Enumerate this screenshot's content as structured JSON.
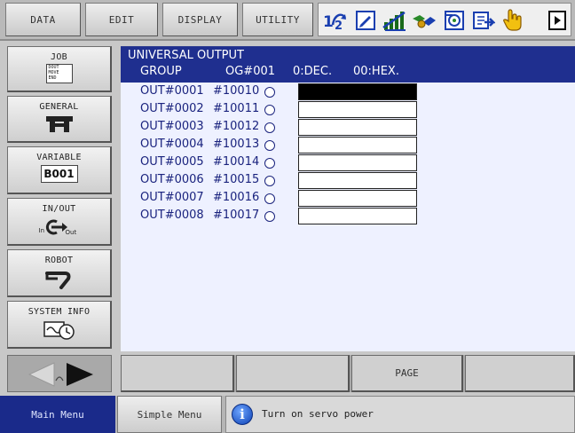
{
  "menu": {
    "data": "DATA",
    "edit": "EDIT",
    "display": "DISPLAY",
    "utility": "UTILITY"
  },
  "status_icons": [
    "teach-mode-icon",
    "edit-lock-icon",
    "signal-level-icon",
    "coordinate-tool-icon",
    "servo-status-icon",
    "play-step-icon",
    "hand-pointer-icon",
    "page-next-icon"
  ],
  "sidebar": {
    "job": {
      "label": "JOB",
      "icon": "job-document-icon",
      "icon_lines": [
        "DOUT",
        "MOVE",
        "END"
      ]
    },
    "general": {
      "label": "GENERAL",
      "icon": "general-tool-icon"
    },
    "variable": {
      "label": "VARIABLE",
      "badge": "B001"
    },
    "inout": {
      "label": "IN/OUT",
      "icon": "inout-arrow-icon",
      "in": "In",
      "out": "Out"
    },
    "robot": {
      "label": "ROBOT",
      "icon": "robot-arm-icon"
    },
    "sysinfo": {
      "label": "SYSTEM INFO",
      "icon": "system-info-icon"
    }
  },
  "panel": {
    "title": "UNIVERSAL OUTPUT",
    "group_label": "GROUP",
    "group_value": "OG#001",
    "dec_label": "0:DEC.",
    "hex_label": "00:HEX.",
    "rows": [
      {
        "name": "OUT#0001",
        "addr": "#10010"
      },
      {
        "name": "OUT#0002",
        "addr": "#10011"
      },
      {
        "name": "OUT#0003",
        "addr": "#10012"
      },
      {
        "name": "OUT#0004",
        "addr": "#10013"
      },
      {
        "name": "OUT#0005",
        "addr": "#10014"
      },
      {
        "name": "OUT#0006",
        "addr": "#10015"
      },
      {
        "name": "OUT#0007",
        "addr": "#10016"
      },
      {
        "name": "OUT#0008",
        "addr": "#10017"
      }
    ]
  },
  "function_keys": [
    "",
    "",
    "PAGE",
    ""
  ],
  "bottom": {
    "main_menu": "Main Menu",
    "simple_menu": "Simple Menu",
    "message": "Turn on servo power"
  },
  "colors": {
    "header_bg": "#1f2f8f",
    "panel_bg": "#eef1ff",
    "text_blue": "#1a237e",
    "main_menu_bg": "#1a2a8a"
  }
}
